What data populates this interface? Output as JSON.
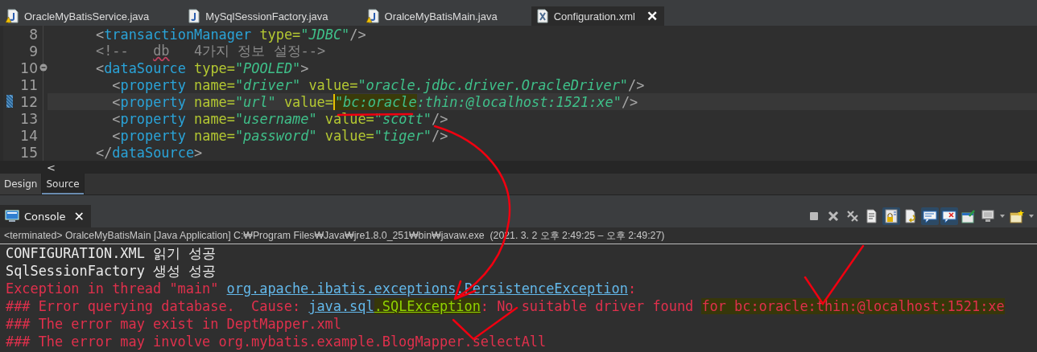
{
  "editor_tabs": [
    {
      "label": "OracleMyBatisService.java",
      "kind": "java",
      "warning": true,
      "selected": false
    },
    {
      "label": "MySqlSessionFactory.java",
      "kind": "java",
      "warning": false,
      "selected": false
    },
    {
      "label": "OralceMyBatisMain.java",
      "kind": "java",
      "warning": true,
      "selected": false
    },
    {
      "label": "Configuration.xml",
      "kind": "xml",
      "warning": false,
      "selected": true,
      "close": "✕"
    }
  ],
  "editor": {
    "lines": [
      {
        "number": "8",
        "current": false,
        "fold": false,
        "marker": false,
        "segments": [
          {
            "text": "      <",
            "kind": "punct"
          },
          {
            "text": "transactionManager",
            "kind": "tag"
          },
          {
            "text": " type=",
            "kind": "attr"
          },
          {
            "text": "\"JDBC\"",
            "kind": "value"
          },
          {
            "text": "/>",
            "kind": "punct"
          }
        ]
      },
      {
        "number": "9",
        "current": false,
        "fold": false,
        "marker": false,
        "segments": [
          {
            "text": "      <!--   ",
            "kind": "comment"
          },
          {
            "text": "db",
            "kind": "spell"
          },
          {
            "text": "   4가지 정보 설정-->",
            "kind": "comment"
          }
        ]
      },
      {
        "number": "10",
        "current": false,
        "fold": true,
        "marker": false,
        "segments": [
          {
            "text": "      <",
            "kind": "punct"
          },
          {
            "text": "dataSource",
            "kind": "tag"
          },
          {
            "text": " type=",
            "kind": "attr"
          },
          {
            "text": "\"POOLED\"",
            "kind": "value"
          },
          {
            "text": ">",
            "kind": "punct"
          }
        ]
      },
      {
        "number": "11",
        "current": false,
        "fold": false,
        "marker": false,
        "segments": [
          {
            "text": "        <",
            "kind": "punct"
          },
          {
            "text": "property",
            "kind": "tag"
          },
          {
            "text": " name=",
            "kind": "attr"
          },
          {
            "text": "\"driver\"",
            "kind": "value"
          },
          {
            "text": " value=",
            "kind": "attr"
          },
          {
            "text": "\"oracle.jdbc.driver.OracleDriver\"",
            "kind": "value"
          },
          {
            "text": "/>",
            "kind": "punct"
          }
        ]
      },
      {
        "number": "12",
        "current": true,
        "fold": false,
        "marker": true,
        "segments": [
          {
            "text": "        <",
            "kind": "punct"
          },
          {
            "text": "property",
            "kind": "tag"
          },
          {
            "text": " name=",
            "kind": "attr"
          },
          {
            "text": "\"url\"",
            "kind": "value"
          },
          {
            "text": " value=",
            "kind": "attr"
          },
          {
            "text": "\"bc:oracle",
            "kind": "value-hl"
          },
          {
            "text": ":thin:@localhost:1521:xe\"",
            "kind": "value"
          },
          {
            "text": "/>",
            "kind": "punct"
          }
        ]
      },
      {
        "number": "13",
        "current": false,
        "fold": false,
        "marker": false,
        "segments": [
          {
            "text": "        <",
            "kind": "punct"
          },
          {
            "text": "property",
            "kind": "tag"
          },
          {
            "text": " name=",
            "kind": "attr"
          },
          {
            "text": "\"username\"",
            "kind": "value"
          },
          {
            "text": " value=",
            "kind": "attr"
          },
          {
            "text": "\"scott\"",
            "kind": "value"
          },
          {
            "text": "/>",
            "kind": "punct"
          }
        ]
      },
      {
        "number": "14",
        "current": false,
        "fold": false,
        "marker": false,
        "segments": [
          {
            "text": "        <",
            "kind": "punct"
          },
          {
            "text": "property",
            "kind": "tag"
          },
          {
            "text": " name=",
            "kind": "attr"
          },
          {
            "text": "\"password\"",
            "kind": "value"
          },
          {
            "text": " value=",
            "kind": "attr"
          },
          {
            "text": "\"tiger\"",
            "kind": "value"
          },
          {
            "text": "/>",
            "kind": "punct"
          }
        ]
      },
      {
        "number": "15",
        "current": false,
        "fold": false,
        "marker": false,
        "segments": [
          {
            "text": "      </",
            "kind": "punct"
          },
          {
            "text": "dataSource",
            "kind": "tag"
          },
          {
            "text": ">",
            "kind": "punct"
          }
        ]
      }
    ],
    "scroll_left": "<"
  },
  "page_tabs": [
    {
      "label": "Design",
      "selected": false
    },
    {
      "label": "Source",
      "selected": true
    }
  ],
  "console": {
    "title": "Console",
    "close": "✕",
    "toolbar": [
      {
        "kind": "stop"
      },
      {
        "kind": "remove"
      },
      {
        "kind": "remove-all"
      },
      {
        "kind": "clear",
        "selected": false
      },
      {
        "kind": "scroll-lock",
        "selected": true
      },
      {
        "kind": "word-wrap",
        "selected": false
      },
      {
        "kind": "show-out",
        "selected": true
      },
      {
        "kind": "show-err",
        "selected": true
      },
      {
        "kind": "pin",
        "selected": false
      },
      {
        "kind": "display",
        "selected": false
      },
      {
        "kind": "caret"
      },
      {
        "kind": "new-console",
        "selected": false
      },
      {
        "kind": "caret"
      }
    ],
    "status": "<terminated> OralceMyBatisMain [Java Application] C:₩Program Files₩Java₩jre1.8.0_251₩bin₩javaw.exe  (2021. 3. 2 오후 2:49:25 – 오후 2:49:27)",
    "lines": [
      {
        "segments": [
          {
            "text": "CONFIGURATION.XML 읽기 성공",
            "kind": "out"
          }
        ]
      },
      {
        "segments": [
          {
            "text": "SqlSessionFactory 생성 성공",
            "kind": "out"
          }
        ]
      },
      {
        "segments": [
          {
            "text": "Exception in thread \"main\" ",
            "kind": "err"
          },
          {
            "text": "org.apache.ibatis.exceptions.PersistenceException",
            "kind": "link"
          },
          {
            "text": ":",
            "kind": "err"
          }
        ]
      },
      {
        "segments": [
          {
            "text": "### Error querying database.  Cause: ",
            "kind": "err"
          },
          {
            "text": "java.sql",
            "kind": "link"
          },
          {
            "text": ".SQLException",
            "kind": "link-hl"
          },
          {
            "text": ": No suitable driver found ",
            "kind": "err"
          },
          {
            "text": "for bc:oracle:thin:@localhost:1521:xe",
            "kind": "err-hl"
          }
        ]
      },
      {
        "segments": [
          {
            "text": "### The error may exist in DeptMapper.xml",
            "kind": "err"
          }
        ]
      },
      {
        "segments": [
          {
            "text": "### The error may involve org.mybatis.example.BlogMapper.selectAll",
            "kind": "err"
          }
        ]
      }
    ]
  }
}
